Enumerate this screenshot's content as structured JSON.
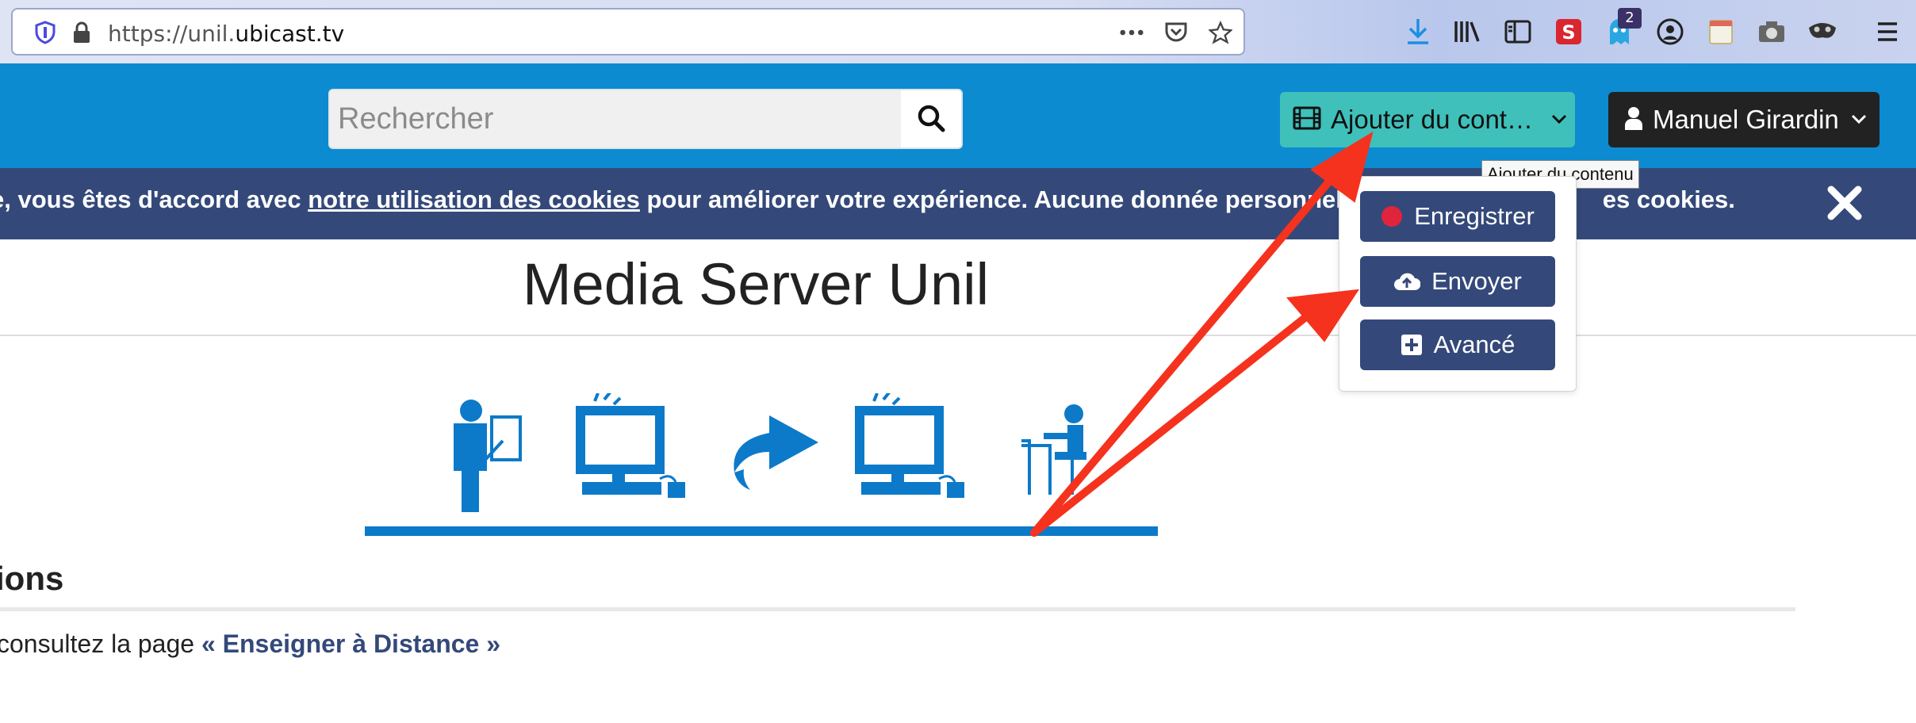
{
  "browser": {
    "url_prefix": "https://unil.",
    "url_domain": "ubicast.tv",
    "notification_badge": "2",
    "icons": [
      "shield-icon",
      "lock-icon",
      "more-icon",
      "pocket-icon",
      "star-icon",
      "download-icon",
      "library-icon",
      "sidebar-icon",
      "extension-icon",
      "ghostery-icon",
      "account-icon",
      "notes-icon",
      "camera-icon",
      "mask-icon",
      "menu-icon"
    ]
  },
  "header": {
    "search_placeholder": "Rechercher",
    "add_content_label": "Ajouter du cont…",
    "add_content_tooltip": "Ajouter du contenu",
    "user_name": "Manuel Girardin"
  },
  "dropdown": {
    "items": [
      {
        "label": "Enregistrer",
        "icon": "record-icon"
      },
      {
        "label": "Envoyer",
        "icon": "cloud-upload-icon"
      },
      {
        "label": "Avancé",
        "icon": "plus-square-icon"
      }
    ]
  },
  "cookie_bar": {
    "text_before": "e, vous êtes d'accord avec ",
    "link": "notre utilisation des cookies",
    "text_after": " pour améliorer votre expérience. Aucune donnée personnelle",
    "text_end": "es cookies."
  },
  "page": {
    "title": "Media Server Unil",
    "section_title": "ions",
    "para_before": "consultez la page ",
    "para_link": "« Enseigner à Distance »"
  },
  "colors": {
    "header_blue": "#0c8bd1",
    "cookie_navy": "#34497a",
    "add_teal": "#3fc0ba",
    "annotation_red": "#f5321e",
    "record_red": "#e0243c"
  }
}
